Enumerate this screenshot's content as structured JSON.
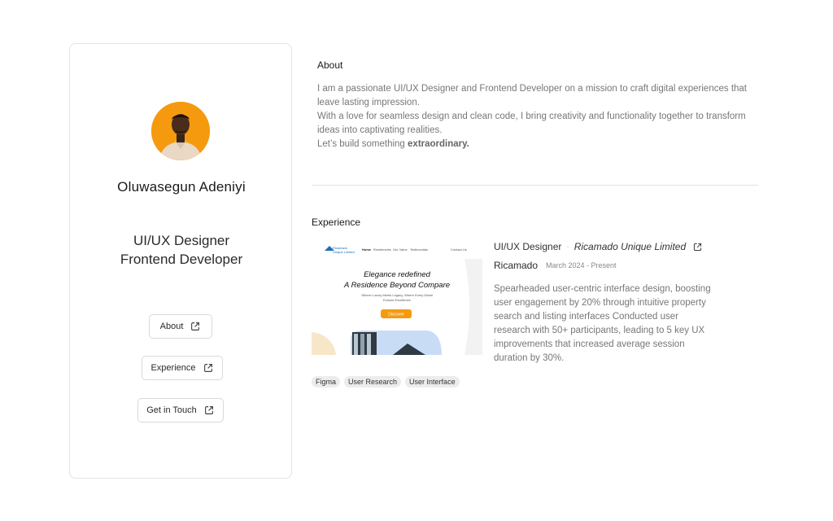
{
  "profile": {
    "name": "Oluwasegun Adeniyi",
    "role_line1": "UI/UX Designer",
    "role_line2": "Frontend Developer",
    "nav": [
      {
        "label": "About",
        "icon": "external-link-icon"
      },
      {
        "label": "Experience",
        "icon": "external-link-icon"
      },
      {
        "label": "Get in Touch",
        "icon": "external-link-icon"
      }
    ]
  },
  "about": {
    "title": "About",
    "lines": [
      "I am a passionate UI/UX Designer and Frontend Developer on a mission to craft digital experiences that leave lasting impression.",
      "With a love for seamless design and clean code, I bring creativity and functionality together to transform ideas into captivating realities."
    ],
    "closing_prefix": "Let’s build something ",
    "closing_bold": "extraordinary."
  },
  "experience": {
    "title": "Experience",
    "items": [
      {
        "role": "UI/UX Designer",
        "company_link": "Ricamado Unique Limited",
        "company": "Ricamado",
        "date": "March 2024 - Present",
        "description": "Spearheaded user-centric interface design, boosting  user engagement by 20% through intuitive property  search and listing interfaces Conducted user research with 50+ participants, leading  to 5 key UX improvements that increased average  session duration by 30%.",
        "tags": [
          "Figma",
          "User Research",
          "User Interface"
        ],
        "preview": {
          "logo": "Ricamado",
          "logo_sub": "Unique Limited",
          "menu": [
            "Home",
            "Residencies",
            "Our Value",
            "Testimonials"
          ],
          "contact": "Contact Us",
          "heading1": "Elegance redefined",
          "heading2": "A Residence Beyond Compare",
          "sub1": "Where Luxury Meets Legacy, Where Every Detail",
          "sub2": "Echoes Excellence",
          "cta": "Discover"
        }
      }
    ]
  },
  "colors": {
    "accent": "#f59a0f",
    "border": "#e4e4e4",
    "muted_text": "#777777"
  }
}
